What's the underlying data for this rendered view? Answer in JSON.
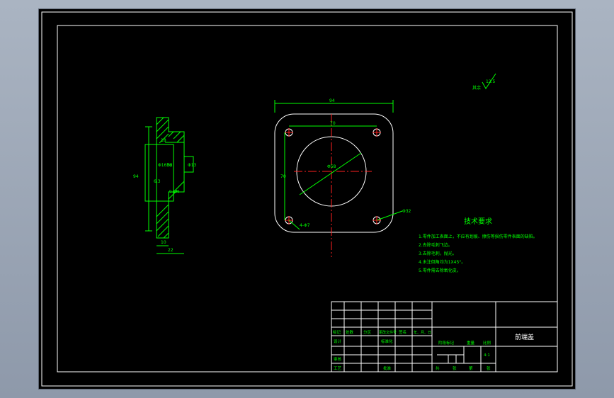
{
  "colors": {
    "line": "#00ff00",
    "outline": "#ffffff",
    "centerline": "#ff2020",
    "background": "#000000"
  },
  "section_view": {
    "dimensions": {
      "height": "94",
      "bore_inner": "18",
      "bore_dia": "Φ13",
      "step": "32",
      "flange_dia": "Φ16h6",
      "thickness": "10",
      "total_length": "22",
      "small": "0.186",
      "chamfer": "6.3"
    }
  },
  "front_view": {
    "dimensions": {
      "width": "94",
      "hole_spacing_h": "70",
      "hole_spacing_v": "70",
      "bore": "Φ58",
      "holes": "4-Φ7",
      "bolt_circle": "Φ32"
    }
  },
  "surface_finish": {
    "value": "12.5",
    "label": "其余"
  },
  "tech_req": {
    "title": "技术要求",
    "items": [
      "1.零件加工表面上，不应有划痕、擦伤等损伤零件表面的缺陷。",
      "2.去除毛刺飞边。",
      "3.去除毛刺，抛光。",
      "4.未注倒角均为1X45°。",
      "5.零件需去除氧化皮。"
    ]
  },
  "title_block": {
    "part_name": "前端盖",
    "row_labels": [
      "标记",
      "处数",
      "分区",
      "更改文件号",
      "签名",
      "年、月、日"
    ],
    "designer": "设计",
    "standardization": "标准化",
    "review": "审核",
    "process": "工艺",
    "approve": "批准",
    "stage_mark": "阶段标记",
    "weight": "重量",
    "scale_label": "比例",
    "scale": "4:1",
    "sheets": [
      "共",
      "张",
      "第",
      "张"
    ]
  }
}
